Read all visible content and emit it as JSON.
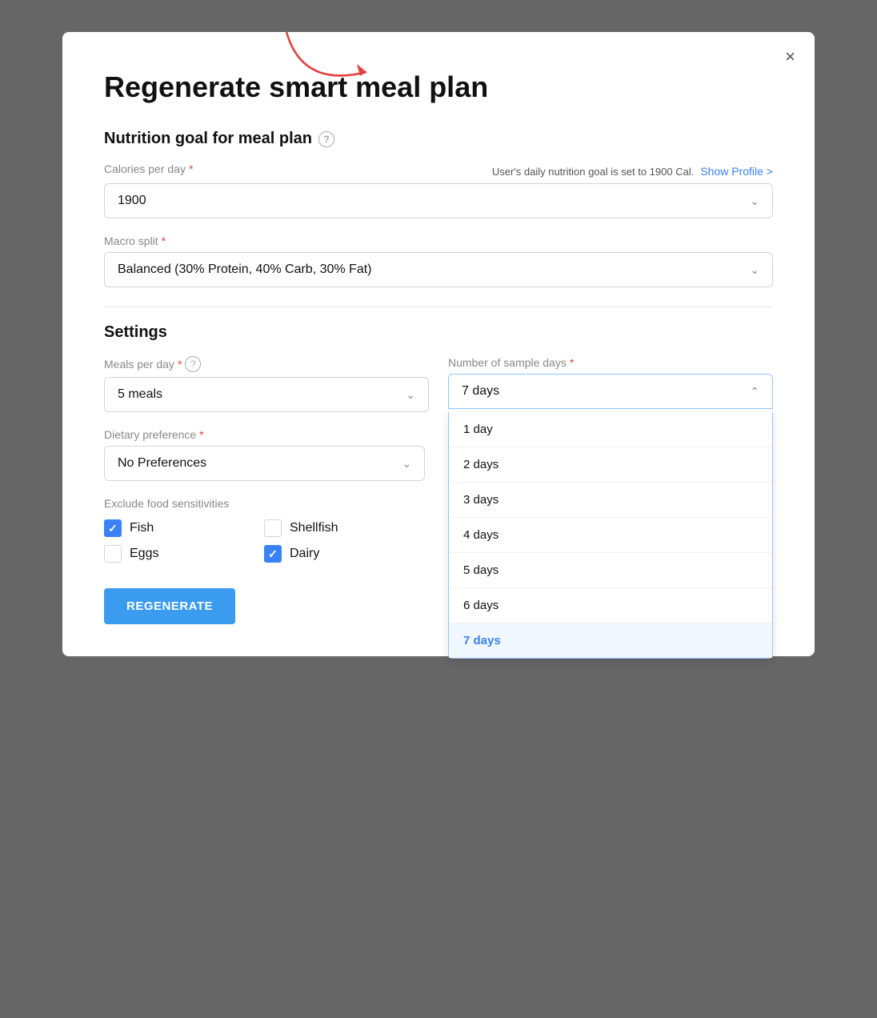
{
  "modal": {
    "title": "Regenerate smart meal plan",
    "close_label": "×"
  },
  "nutrition_section": {
    "title": "Nutrition goal for meal plan",
    "calories_label": "Calories per day",
    "calories_hint": "User's daily nutrition goal is set to 1900 Cal.",
    "show_profile_label": "Show Profile >",
    "calories_value": "1900",
    "macro_label": "Macro split",
    "macro_value": "Balanced (30% Protein, 40% Carb, 30% Fat)"
  },
  "settings_section": {
    "title": "Settings",
    "meals_label": "Meals per day",
    "meals_value": "5 meals",
    "sample_days_label": "Number of sample days",
    "sample_days_value": "7 days",
    "sample_days_options": [
      {
        "label": "1 day",
        "selected": false
      },
      {
        "label": "2 days",
        "selected": false
      },
      {
        "label": "3 days",
        "selected": false
      },
      {
        "label": "4 days",
        "selected": false
      },
      {
        "label": "5 days",
        "selected": false
      },
      {
        "label": "6 days",
        "selected": false
      },
      {
        "label": "7 days",
        "selected": true
      }
    ],
    "dietary_label": "Dietary preference",
    "dietary_value": "No Preferences",
    "exclude_label": "Exclude food sensitivities",
    "checkboxes": [
      {
        "label": "Fish",
        "checked": true
      },
      {
        "label": "Shellfish",
        "checked": false
      },
      {
        "label": "Eggs",
        "checked": false
      },
      {
        "label": "Dairy",
        "checked": true
      }
    ]
  },
  "regenerate_btn": "REGENERATE"
}
